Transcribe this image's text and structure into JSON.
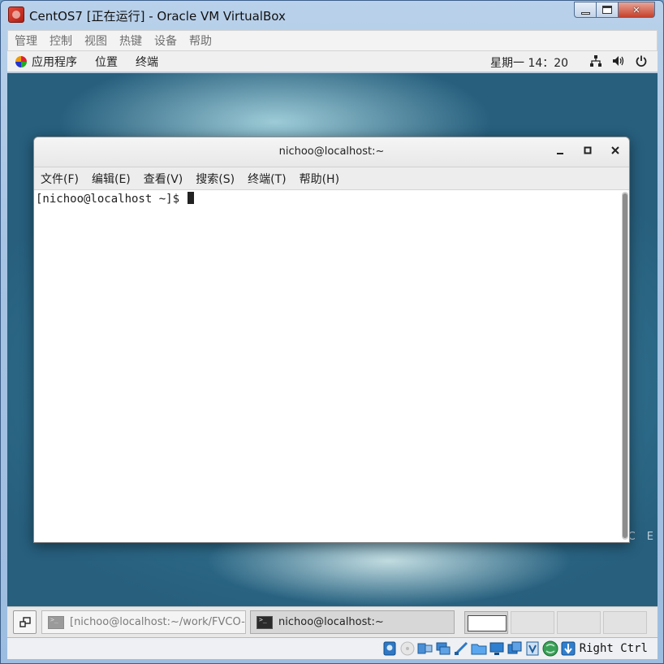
{
  "host_window": {
    "title": "CentOS7 [正在运行] - Oracle VM VirtualBox",
    "menu": [
      "管理",
      "控制",
      "视图",
      "热键",
      "设备",
      "帮助"
    ]
  },
  "gnome_topbar": {
    "menu": [
      "应用程序",
      "位置",
      "终端"
    ],
    "clock": "星期一 14：20"
  },
  "desktop": {
    "brand_text": "C E"
  },
  "terminal": {
    "title": "nichoo@localhost:~",
    "menu": [
      "文件(F)",
      "编辑(E)",
      "查看(V)",
      "搜索(S)",
      "终端(T)",
      "帮助(H)"
    ],
    "prompt": "[nichoo@localhost ~]$ "
  },
  "taskbar": {
    "tasks": [
      {
        "label": "[nichoo@localhost:~/work/FVCO-..."
      },
      {
        "label": "nichoo@localhost:~"
      }
    ]
  },
  "statusbar": {
    "host_key": "Right Ctrl"
  }
}
